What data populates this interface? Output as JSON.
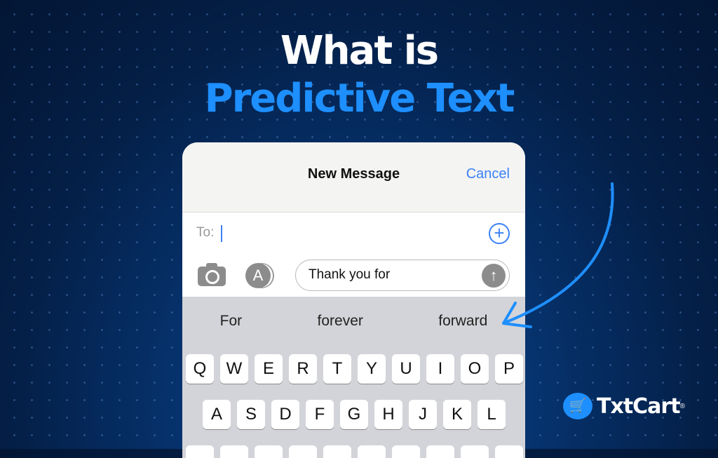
{
  "headline": {
    "line1": "What is",
    "line2": "Predictive Text"
  },
  "phone": {
    "title": "New Message",
    "cancel": "Cancel",
    "to_label": "To:",
    "message_text": "Thank you for",
    "suggestions": [
      "For",
      "forever",
      "forward"
    ],
    "keyboard": {
      "row1": [
        "Q",
        "W",
        "E",
        "R",
        "T",
        "Y",
        "U",
        "I",
        "O",
        "P"
      ],
      "row2": [
        "A",
        "S",
        "D",
        "F",
        "G",
        "H",
        "J",
        "K",
        "L"
      ]
    },
    "icons": {
      "camera": "camera-icon",
      "apps": "app-store-icon",
      "send": "arrow-up-icon",
      "add": "plus-circle-icon"
    }
  },
  "brand": {
    "name": "TxtCart",
    "registered": "®",
    "accent": "#1e8fff"
  },
  "colors": {
    "background": "#04214d",
    "accent": "#1e8fff",
    "ios_blue": "#3b82f6"
  }
}
